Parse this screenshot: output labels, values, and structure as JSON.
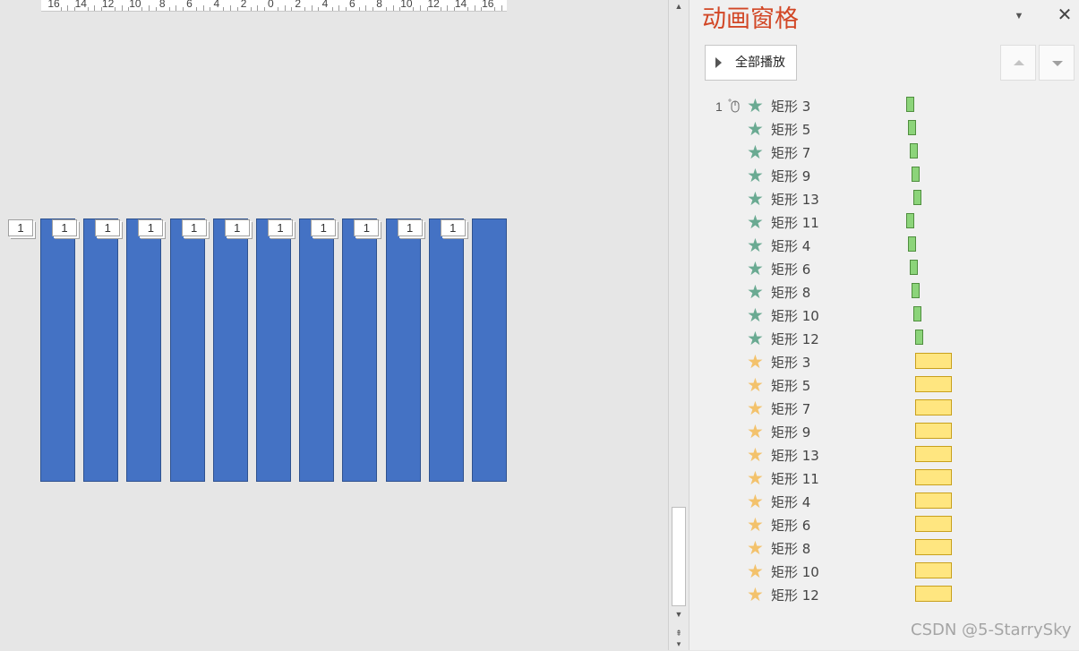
{
  "ruler": {
    "labels": [
      "16",
      "14",
      "12",
      "10",
      "8",
      "6",
      "4",
      "2",
      "0",
      "2",
      "4",
      "6",
      "8",
      "10",
      "12",
      "14",
      "16"
    ]
  },
  "slide": {
    "bar_count": 11,
    "bar_color": "#4472c4",
    "tags": [
      "1",
      "1",
      "1",
      "1",
      "1",
      "1",
      "1",
      "1",
      "1",
      "1",
      "1"
    ]
  },
  "pane": {
    "title": "动画窗格",
    "menu_icon": "chevron-down-icon",
    "close_icon": "close-icon",
    "play_all_label": "全部播放",
    "move_up_icon": "triangle-up-icon",
    "move_down_icon": "triangle-down-icon",
    "first_row_number": "1",
    "items": [
      {
        "label": "矩形 3",
        "effect": "green",
        "offset": 0
      },
      {
        "label": "矩形 5",
        "effect": "green",
        "offset": 1
      },
      {
        "label": "矩形 7",
        "effect": "green",
        "offset": 2
      },
      {
        "label": "矩形 9",
        "effect": "green",
        "offset": 3
      },
      {
        "label": "矩形 13",
        "effect": "green",
        "offset": 4
      },
      {
        "label": "矩形 11",
        "effect": "green",
        "offset": 0
      },
      {
        "label": "矩形 4",
        "effect": "green",
        "offset": 1
      },
      {
        "label": "矩形 6",
        "effect": "green",
        "offset": 2
      },
      {
        "label": "矩形 8",
        "effect": "green",
        "offset": 3
      },
      {
        "label": "矩形 10",
        "effect": "green",
        "offset": 4
      },
      {
        "label": "矩形 12",
        "effect": "green",
        "offset": 5
      },
      {
        "label": "矩形 3",
        "effect": "yellow",
        "offset": 0
      },
      {
        "label": "矩形 5",
        "effect": "yellow",
        "offset": 0
      },
      {
        "label": "矩形 7",
        "effect": "yellow",
        "offset": 0
      },
      {
        "label": "矩形 9",
        "effect": "yellow",
        "offset": 0
      },
      {
        "label": "矩形 13",
        "effect": "yellow",
        "offset": 0
      },
      {
        "label": "矩形 11",
        "effect": "yellow",
        "offset": 0
      },
      {
        "label": "矩形 4",
        "effect": "yellow",
        "offset": 0
      },
      {
        "label": "矩形 6",
        "effect": "yellow",
        "offset": 0
      },
      {
        "label": "矩形 8",
        "effect": "yellow",
        "offset": 0
      },
      {
        "label": "矩形 10",
        "effect": "yellow",
        "offset": 0
      },
      {
        "label": "矩形 12",
        "effect": "yellow",
        "offset": 0
      }
    ],
    "colors": {
      "title": "#d24726",
      "green_star": "#6aaa92",
      "yellow_star": "#f3c26c",
      "green_bar": "#8cd47a",
      "yellow_bar": "#ffe680"
    }
  },
  "watermark": "CSDN @5-StarrySky"
}
